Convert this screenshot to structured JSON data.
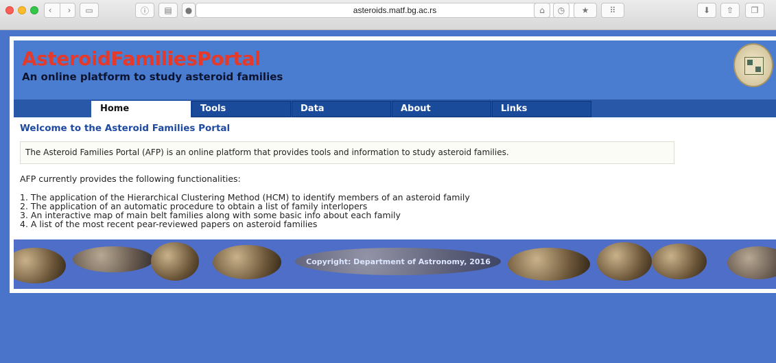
{
  "browser": {
    "url": "asteroids.matf.bg.ac.rs",
    "icons": [
      "back-icon",
      "forward-icon",
      "sidebar-icon",
      "info-icon",
      "print-icon",
      "adblock-icon",
      "reload-icon",
      "home-icon",
      "history-icon",
      "bookmark-icon",
      "grid-icon",
      "download-icon",
      "share-icon",
      "tabs-icon"
    ]
  },
  "site": {
    "title": "AsteroidFamiliesPortal",
    "subtitle": "An online platform to study asteroid families",
    "nav": [
      {
        "label": "Home"
      },
      {
        "label": "Tools"
      },
      {
        "label": "Data"
      },
      {
        "label": "About"
      },
      {
        "label": "Links"
      }
    ]
  },
  "content": {
    "heading": "Welcome to the Asteroid Families Portal",
    "intro": "The Asteroid Families Portal (AFP) is an online platform that provides tools and information to study asteroid families.",
    "lead": "AFP currently provides the following functionalities:",
    "functionalities": [
      "1. The application of the Hierarchical Clustering Method (HCM) to identify members of an asteroid family",
      "2. The application of an automatic procedure to obtain a list of family interlopers",
      "3. An interactive map of main belt families along with some basic info about each family",
      "4. A list of the most recent pear-reviewed papers on asteroid families"
    ]
  },
  "footer": {
    "copyright": "Copyright: Department of Astronomy, 2016"
  },
  "colors": {
    "background": "#4a74c9",
    "header": "#4a7cd0",
    "title_red": "#e43a2c",
    "nav_tab": "#1a4a9a",
    "heading_blue": "#1e4aa0"
  }
}
